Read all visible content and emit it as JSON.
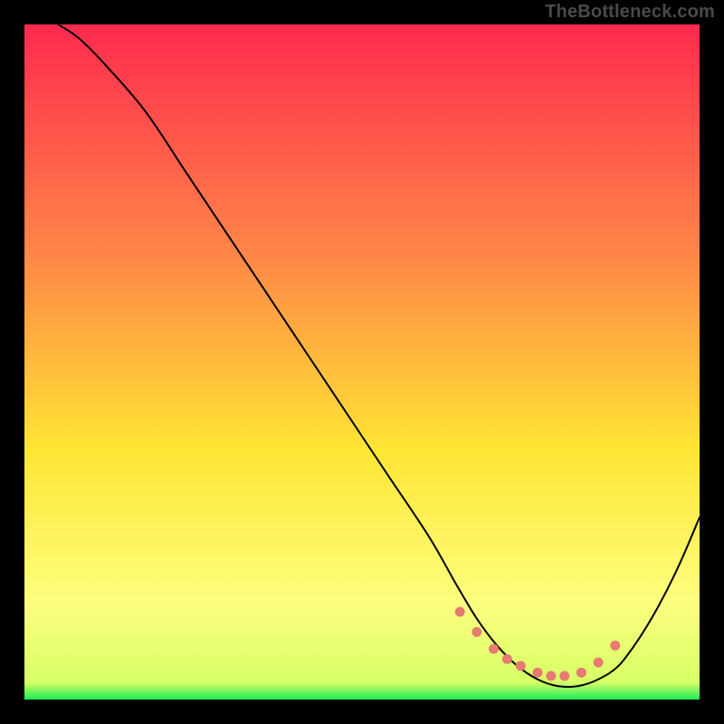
{
  "watermark": "TheBottleneck.com",
  "colors": {
    "gradient_top": "#FF2A4E",
    "gradient_mid1": "#FF8648",
    "gradient_mid2": "#FFE534",
    "gradient_light": "#FDFF7F",
    "gradient_bottom": "#1DEB56",
    "curve": "#000000",
    "dots": "#E77A71",
    "frame": "#000000"
  },
  "chart_data": {
    "type": "line",
    "title": "",
    "xlabel": "",
    "ylabel": "",
    "xlim": [
      0,
      100
    ],
    "ylim": [
      0,
      100
    ],
    "series": [
      {
        "name": "bottleneck-curve",
        "x": [
          5,
          8,
          12,
          18,
          24,
          30,
          36,
          42,
          48,
          54,
          60,
          64,
          67,
          70,
          73,
          76,
          79,
          82,
          85,
          88,
          91,
          94,
          97,
          100
        ],
        "y": [
          100,
          98,
          94,
          87,
          78,
          69,
          60,
          51,
          42,
          33,
          24,
          17,
          12,
          8,
          5,
          3,
          2,
          2,
          3,
          5,
          9,
          14,
          20,
          27
        ]
      }
    ],
    "highlight_points": {
      "name": "optimal-zone-dots",
      "x": [
        64.5,
        67,
        69.5,
        71.5,
        73.5,
        76,
        78,
        80,
        82.5,
        85,
        87.5
      ],
      "y": [
        13,
        10,
        7.5,
        6,
        5,
        4,
        3.5,
        3.5,
        4,
        5.5,
        8
      ]
    }
  }
}
